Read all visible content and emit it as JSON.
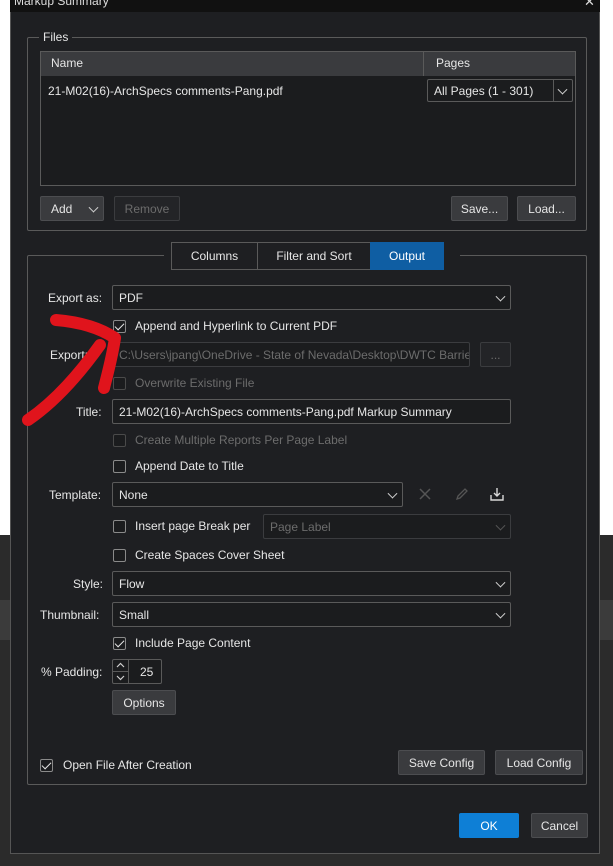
{
  "window": {
    "title": "Markup Summary",
    "close_glyph": "✕"
  },
  "files": {
    "legend": "Files",
    "columns": {
      "name": "Name",
      "pages": "Pages"
    },
    "rows": [
      {
        "name": "21-M02(16)-ArchSpecs comments-Pang.pdf",
        "pages": "All Pages (1 - 301)"
      }
    ],
    "add_label": "Add",
    "remove_label": "Remove",
    "save_label": "Save...",
    "load_label": "Load..."
  },
  "tabs": [
    {
      "label": "Columns",
      "active": false
    },
    {
      "label": "Filter and Sort",
      "active": false
    },
    {
      "label": "Output",
      "active": true
    }
  ],
  "output": {
    "export_as_label": "Export as:",
    "export_as_value": "PDF",
    "append_hyperlink_label": "Append and Hyperlink to Current PDF",
    "append_hyperlink_checked": true,
    "export_path_label": "Export:",
    "export_path_value": "C:\\Users\\jpang\\OneDrive - State of Nevada\\Desktop\\DWTC Barrie",
    "browse_label": "...",
    "overwrite_label": "Overwrite Existing File",
    "overwrite_checked": false,
    "title_label": "Title:",
    "title_value": "21-M02(16)-ArchSpecs comments-Pang.pdf Markup Summary",
    "multiple_reports_label": "Create Multiple Reports Per Page Label",
    "multiple_reports_checked": false,
    "append_date_label": "Append Date to Title",
    "append_date_checked": false,
    "template_label": "Template:",
    "template_value": "None",
    "insert_break_label": "Insert page Break per",
    "insert_break_checked": false,
    "page_label_value": "Page Label",
    "spaces_cover_label": "Create Spaces Cover Sheet",
    "spaces_cover_checked": false,
    "style_label": "Style:",
    "style_value": "Flow",
    "thumbnail_label": "Thumbnail:",
    "thumbnail_value": "Small",
    "include_page_label": "Include Page Content",
    "include_page_checked": true,
    "padding_label": "% Padding:",
    "padding_value": "25",
    "options_label": "Options",
    "open_after_label": "Open File After Creation",
    "open_after_checked": true,
    "save_config_label": "Save Config",
    "load_config_label": "Load Config"
  },
  "footer": {
    "ok_label": "OK",
    "cancel_label": "Cancel"
  },
  "colors": {
    "accent": "#0e7fd6",
    "tab_active": "#0f5ea3",
    "annotation_arrow": "#e0141c"
  }
}
